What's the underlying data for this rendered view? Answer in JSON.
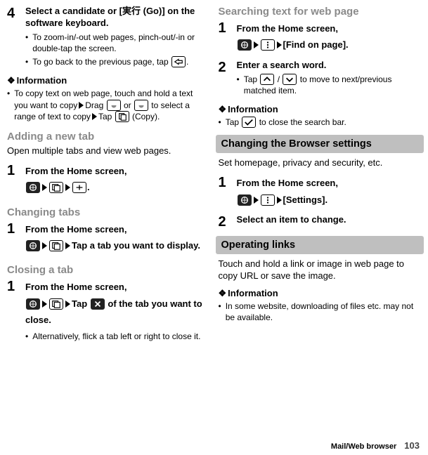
{
  "left": {
    "step4": {
      "num": "4",
      "title_a": "Select a candidate or [",
      "title_b": "実行 (Go)] on the software keyboard.",
      "b1": "To zoom-in/-out web pages, pinch-out/-in or double-tap the screen.",
      "b2a": "To go back to the previous page, tap ",
      "b2b": "."
    },
    "info1": {
      "h": "Information",
      "t1": "To copy text on web page, touch and hold a text you want to copy",
      "t2": "Drag ",
      "t3": " or ",
      "t4": " to select a range of text to copy",
      "t5": "Tap ",
      "t6": " (Copy)."
    },
    "adding": {
      "h": "Adding a new tab",
      "intro": "Open multiple tabs and view web pages.",
      "s1num": "1",
      "s1a": "From the Home screen, ",
      "s1b": "."
    },
    "changing": {
      "h": "Changing tabs",
      "s1num": "1",
      "s1a": "From the Home screen, ",
      "s1b": "Tap a tab you want to display."
    },
    "closing": {
      "h": "Closing a tab",
      "s1num": "1",
      "s1a": "From the Home screen, ",
      "s1b": "Tap ",
      "s1c": " of the tab you want to close.",
      "b1": "Alternatively, flick a tab left or right to close it."
    }
  },
  "right": {
    "searching": {
      "h": "Searching text for web page",
      "s1num": "1",
      "s1a": "From the Home screen, ",
      "s1b": "[Find on page].",
      "s2num": "2",
      "s2a": "Enter a search word.",
      "b1a": "Tap ",
      "b1b": " / ",
      "b1c": " to move to next/previous matched item.",
      "infoh": "Information",
      "info1a": "Tap ",
      "info1b": " to close the search bar."
    },
    "settings": {
      "band": "Changing the Browser settings",
      "intro": "Set homepage, privacy and security, etc.",
      "s1num": "1",
      "s1a": "From the Home screen, ",
      "s1b": "[Settings].",
      "s2num": "2",
      "s2a": "Select an item to change."
    },
    "links": {
      "band": "Operating links",
      "intro": "Touch and hold a link or image in web page to copy URL or save the image.",
      "infoh": "Information",
      "info1": "In some website, downloading of files etc. may not be available."
    }
  },
  "footer": {
    "section": "Mail/Web browser",
    "page": "103"
  }
}
